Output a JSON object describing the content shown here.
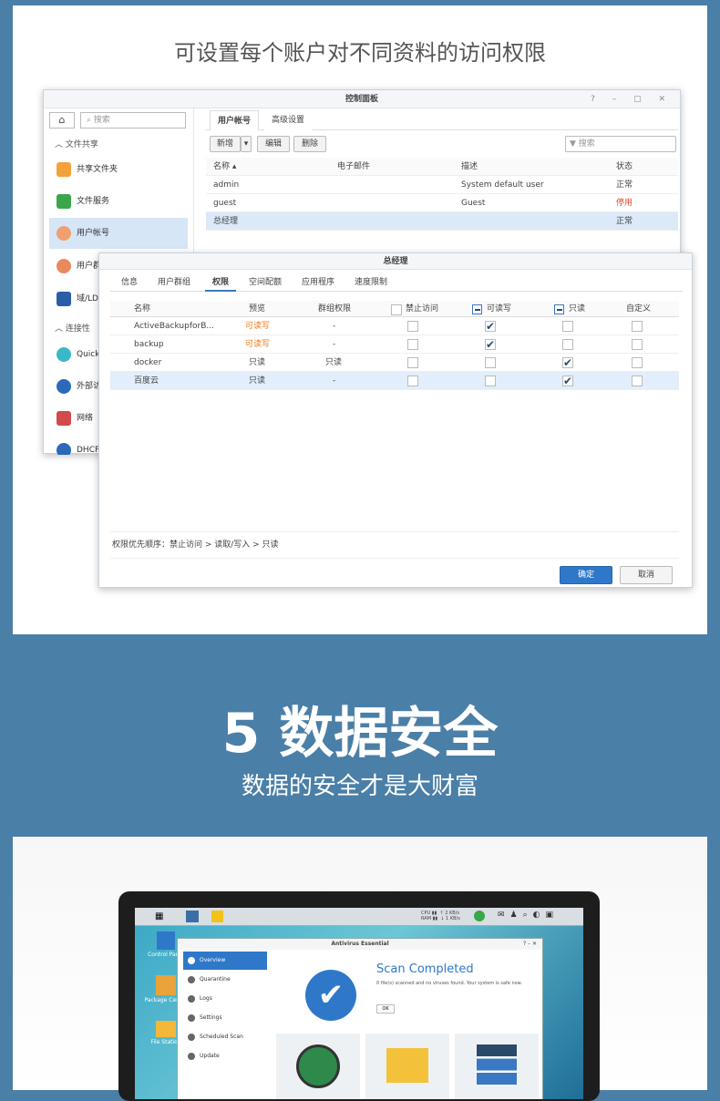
{
  "top": {
    "heading": "可设置每个账户对不同资料的访问权限"
  },
  "cp": {
    "title": "控制面板",
    "window_controls": "? – ▢ ✕",
    "search_placeholder": "搜索",
    "sections": [
      "文件共享",
      "连接性"
    ],
    "items": [
      "共享文件夹",
      "文件服务",
      "用户帐号",
      "用户群",
      "域/LD",
      "Quick",
      "外部访",
      "网络",
      "DHCP"
    ],
    "tabs": [
      "用户帐号",
      "高级设置"
    ],
    "buttons": {
      "new": "新增",
      "edit": "编辑",
      "delete": "删除",
      "dropdown": "▾"
    },
    "filter_placeholder": "搜索",
    "columns": [
      "名称 ▴",
      "电子邮件",
      "描述",
      "状态"
    ],
    "rows": [
      {
        "name": "admin",
        "email": "",
        "desc": "System default user",
        "status": "正常",
        "color": "#444"
      },
      {
        "name": "guest",
        "email": "",
        "desc": "Guest",
        "status": "停用",
        "color": "#e04a2a"
      },
      {
        "name": "总经理",
        "email": "",
        "desc": "",
        "status": "正常",
        "color": "#444"
      }
    ]
  },
  "dlg": {
    "title": "总经理",
    "tabs": [
      "信息",
      "用户群组",
      "权限",
      "空间配额",
      "应用程序",
      "速度限制"
    ],
    "columns": [
      "名称",
      "预览",
      "群组权限",
      "禁止访问",
      "可读写",
      "只读",
      "自定义"
    ],
    "rows": [
      {
        "name": "ActiveBackupforB...",
        "preview": "可读写",
        "group": "-",
        "pcolor": "#f07a1a",
        "deny": false,
        "rw": true,
        "ro": false,
        "custom": false
      },
      {
        "name": "backup",
        "preview": "可读写",
        "group": "-",
        "pcolor": "#f07a1a",
        "deny": false,
        "rw": true,
        "ro": false,
        "custom": false
      },
      {
        "name": "docker",
        "preview": "只读",
        "group": "只读",
        "pcolor": "#444",
        "deny": false,
        "rw": false,
        "ro": true,
        "custom": false
      },
      {
        "name": "百度云",
        "preview": "只读",
        "group": "-",
        "pcolor": "#444",
        "deny": false,
        "rw": false,
        "ro": true,
        "custom": false
      }
    ],
    "priority": "权限优先顺序：禁止访问 > 读取/写入 > 只读",
    "ok": "确定",
    "cancel": "取消"
  },
  "section": {
    "heading": "5 数据安全",
    "sub": "数据的安全才是大财富"
  },
  "screen": {
    "desktop": [
      "Control Panel",
      "Package Center",
      "File Station"
    ],
    "topbar_stats": "CPU ▮▮  ↑ 2 KB/s\nRAM ▮▮  ↓ 1 KB/s",
    "app_title": "Antivirus Essential",
    "app_controls": "? – ✕",
    "menu": [
      "Overview",
      "Quarantine",
      "Logs",
      "Settings",
      "Scheduled Scan",
      "Update"
    ],
    "headline": "Scan Completed",
    "msg": "0 file(s) scanned and no viruses found. Your system is safe now.",
    "ok": "OK"
  }
}
